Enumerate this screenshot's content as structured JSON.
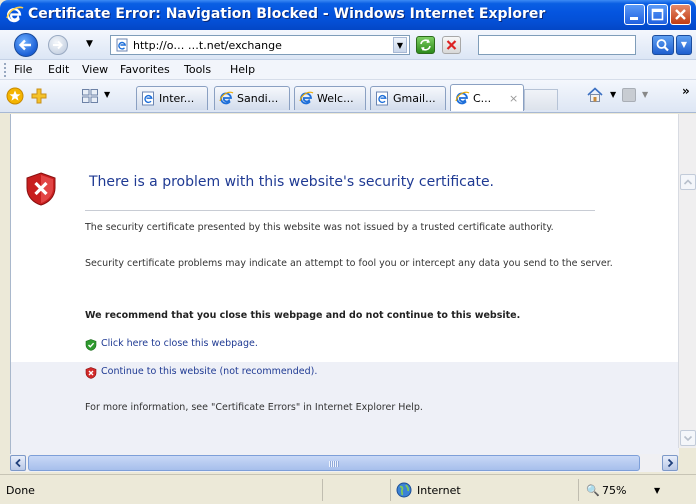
{
  "window": {
    "title": "Certificate Error: Navigation Blocked - Windows Internet Explorer"
  },
  "address_bar": {
    "url": "http://o… …t.net/exchange",
    "search_placeholder": ""
  },
  "menu": [
    "File",
    "Edit",
    "View",
    "Favorites",
    "Tools",
    "Help"
  ],
  "tabs": [
    {
      "label": "Inter...",
      "active": false
    },
    {
      "label": "Sandi...",
      "active": false
    },
    {
      "label": "Welc...",
      "active": false
    },
    {
      "label": "Gmail...",
      "active": false
    },
    {
      "label": "C...",
      "active": true
    }
  ],
  "tab_close_glyph": "×",
  "more_glyph": "»",
  "content": {
    "heading": "There is a problem with this website's security certificate.",
    "msg1": "The security certificate presented by this website was not issued by a trusted certificate authority.",
    "msg2": "Security certificate problems may indicate an attempt to fool you or intercept any data you send to the server.",
    "msg3": "We recommend that you close this webpage and do not continue to this website.",
    "link_close": "Click here to close this webpage.",
    "link_continue": "Continue to this website (not recommended).",
    "msg4": "For more information, see \"Certificate Errors\" in Internet Explorer Help."
  },
  "status": {
    "text": "Done",
    "zone": "Internet",
    "zoom": "75%"
  },
  "icons": {
    "shield_error_color": "#d22a2a",
    "shield_ok_color": "#2e9a2e"
  }
}
